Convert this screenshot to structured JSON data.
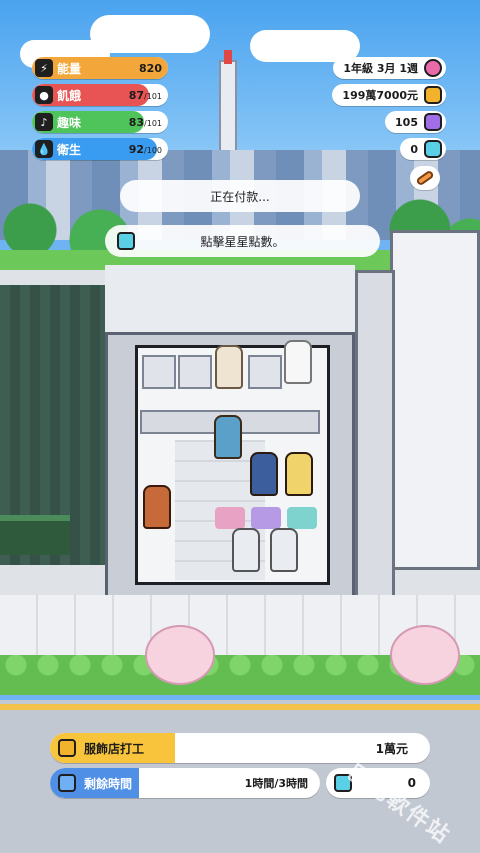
{
  "stats": [
    {
      "label": "能量",
      "value": "820",
      "max": "",
      "fraction": 1.0,
      "color": "#f3a63a",
      "icon": "energy-icon"
    },
    {
      "label": "飢餓",
      "value": "87",
      "max": "/101",
      "fraction": 0.86,
      "color": "#e85454",
      "icon": "hunger-icon"
    },
    {
      "label": "趣味",
      "value": "83",
      "max": "/101",
      "fraction": 0.82,
      "color": "#4fc45a",
      "icon": "fun-icon"
    },
    {
      "label": "衛生",
      "value": "92",
      "max": "/100",
      "fraction": 0.92,
      "color": "#3a9cf0",
      "icon": "hygiene-icon"
    }
  ],
  "info": {
    "date": "1年級 3月 1週",
    "money": "199萬7000元",
    "gems": "105",
    "stars": "0"
  },
  "messages": {
    "paying": "正在付款...",
    "tap_stars": "點擊星星點數。"
  },
  "job": {
    "name": "服飾店打工",
    "pay": "1萬元",
    "progress": 0.33
  },
  "time": {
    "label": "剩餘時間",
    "value": "1時間/3時間",
    "progress": 0.33
  },
  "star_count": "0",
  "watermark": "巴巴軟件站",
  "colors": {
    "job_fill": "#f7c43c",
    "time_fill": "#4f8fe6",
    "date_icon": "#e86aa8",
    "money_icon": "#f3b22b",
    "gem_icon": "#a06ee6",
    "star_icon": "#5ad0e6"
  }
}
